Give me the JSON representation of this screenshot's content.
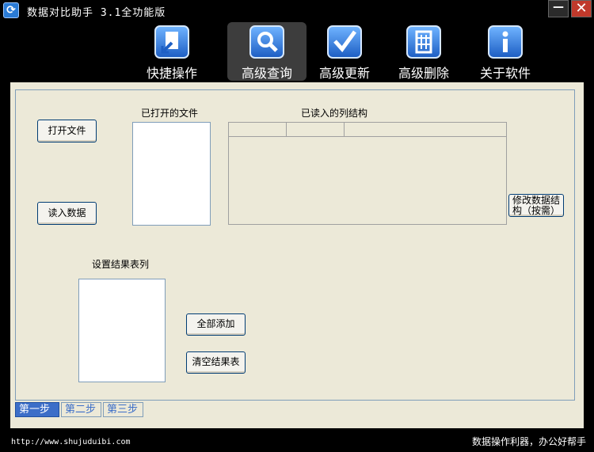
{
  "window": {
    "title": "数据对比助手 3.1全功能版",
    "minimize_label": "—",
    "close_label": "✕"
  },
  "toolbar": {
    "items": [
      {
        "label": "快捷操作",
        "icon": "document-arrow-icon"
      },
      {
        "label": "高级查询",
        "icon": "magnifier-icon",
        "active": true
      },
      {
        "label": "高级更新",
        "icon": "checkmark-icon"
      },
      {
        "label": "高级删除",
        "icon": "trash-icon"
      },
      {
        "label": "关于软件",
        "icon": "info-icon"
      }
    ]
  },
  "step1": {
    "open_file_button": "打开文件",
    "read_data_button": "读入数据",
    "opened_files_label": "已打开的文件",
    "columns_label": "已读入的列结构",
    "modify_structure_button": "修改数据结构（按需）",
    "result_list_label": "设置结果表列",
    "add_all_button": "全部添加",
    "clear_result_button": "清空结果表"
  },
  "tabs": [
    {
      "label": "第一步",
      "active": true
    },
    {
      "label": "第二步"
    },
    {
      "label": "第三步"
    }
  ],
  "status": {
    "url": "http://www.shujuduibi.com",
    "slogan": "数据操作利器，办公好帮手"
  }
}
